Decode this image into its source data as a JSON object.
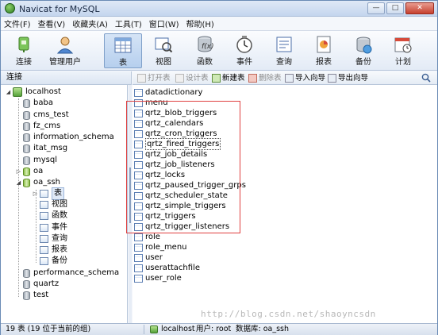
{
  "app": {
    "title": "Navicat for MySQL",
    "controls": {
      "minimize": "—",
      "maximize": "□",
      "close": "✕"
    }
  },
  "menu": [
    "文件(F)",
    "查看(V)",
    "收藏夹(A)",
    "工具(T)",
    "窗口(W)",
    "帮助(H)"
  ],
  "toolbar": {
    "items": [
      {
        "label": "连接",
        "icon": "connection-icon"
      },
      {
        "label": "管理用户",
        "icon": "user-icon"
      },
      {
        "label": "表",
        "icon": "table-icon",
        "active": true
      },
      {
        "label": "视图",
        "icon": "view-icon"
      },
      {
        "label": "函数",
        "icon": "function-icon"
      },
      {
        "label": "事件",
        "icon": "event-icon"
      },
      {
        "label": "查询",
        "icon": "query-icon"
      },
      {
        "label": "报表",
        "icon": "report-icon"
      },
      {
        "label": "备份",
        "icon": "backup-icon"
      },
      {
        "label": "计划",
        "icon": "schedule-icon"
      }
    ]
  },
  "connection_header": "连接",
  "object_toolbar": {
    "open_table": "打开表",
    "design_table": "设计表",
    "new_table": "新建表",
    "delete_table": "删除表",
    "import_wizard": "导入向导",
    "export_wizard": "导出向导"
  },
  "tree": {
    "host": "localhost",
    "databases": [
      "baba",
      "cms_test",
      "fz_cms",
      "information_schema",
      "itat_msg",
      "mysql",
      "oa",
      "oa_ssh"
    ],
    "oa_ssh_children": [
      "表",
      "视图",
      "函数",
      "事件",
      "查询",
      "报表",
      "备份"
    ],
    "databases_after": [
      "performance_schema",
      "quartz",
      "test"
    ]
  },
  "tables": [
    "datadictionary",
    "menu",
    "qrtz_blob_triggers",
    "qrtz_calendars",
    "qrtz_cron_triggers",
    "qrtz_fired_triggers",
    "qrtz_job_details",
    "qrtz_job_listeners",
    "qrtz_locks",
    "qrtz_paused_trigger_grps",
    "qrtz_scheduler_state",
    "qrtz_simple_triggers",
    "qrtz_triggers",
    "qrtz_trigger_listeners",
    "role",
    "role_menu",
    "user",
    "userattachfile",
    "user_role"
  ],
  "selected_table": "qrtz_fired_triggers",
  "watermark": "http://blog.csdn.net/shaoyncsdn",
  "status": {
    "count": "19 表 (19 位于当前的组)",
    "connection": "localhost",
    "user": "用户: root",
    "database": "数据库: oa_ssh"
  },
  "colors": {
    "highlight": "#e04040",
    "accent": "#7fa0c9"
  }
}
